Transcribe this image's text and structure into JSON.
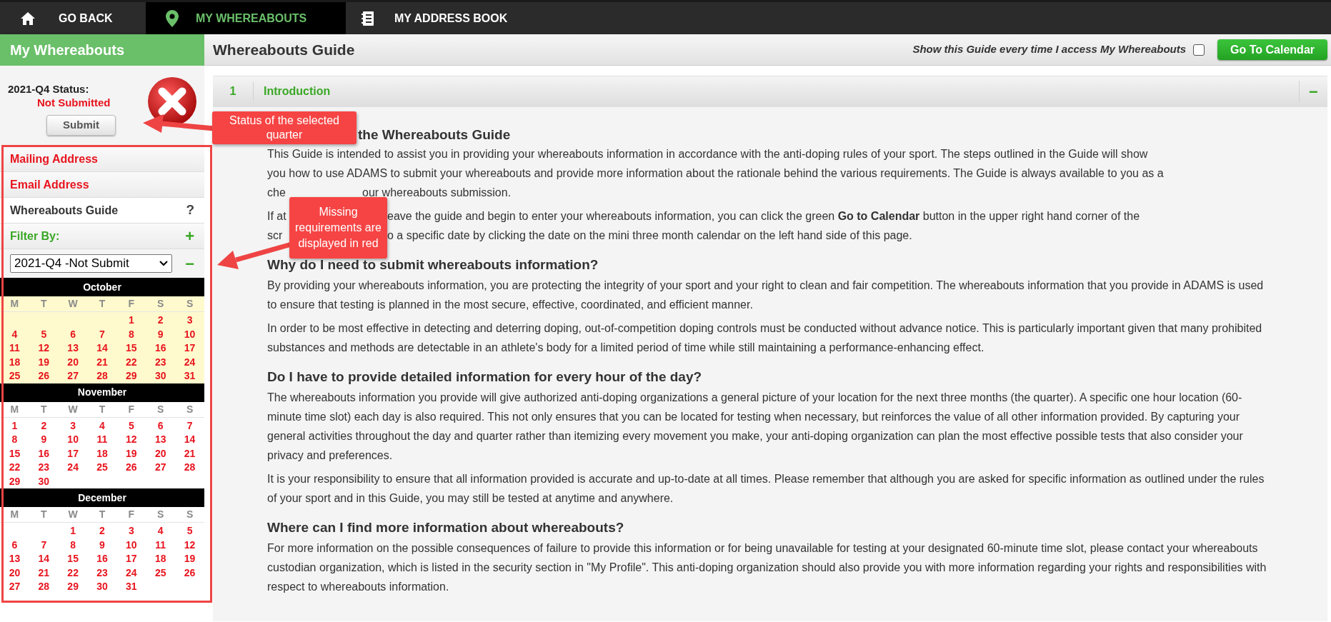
{
  "nav": [
    {
      "label": "GO BACK",
      "selected": false
    },
    {
      "label": "MY WHEREABOUTS",
      "selected": true
    },
    {
      "label": "MY ADDRESS BOOK",
      "selected": false
    }
  ],
  "sidebar": {
    "title": "My Whereabouts",
    "status": {
      "label": "2021-Q4 Status:",
      "value": "Not Submitted",
      "submitted": false
    },
    "submit_button": "Submit",
    "links": [
      {
        "kind": "link",
        "label": "Mailing Address",
        "missing": true
      },
      {
        "kind": "link",
        "label": "Email Address",
        "missing": true
      },
      {
        "kind": "help",
        "label": "Whereabouts Guide",
        "missing": false,
        "symbol": "?"
      },
      {
        "kind": "filter",
        "label": "Filter By:",
        "missing": false,
        "symbol": "+"
      }
    ],
    "quarter_select": {
      "value": "2021-Q4 -Not Submit",
      "symbol": "−"
    },
    "calendar": [
      {
        "month": "October",
        "current_quarter_highlight": true,
        "missing": true,
        "weekdays": [
          "M",
          "T",
          "W",
          "T",
          "F",
          "S",
          "S"
        ],
        "weeks": [
          [
            "1",
            "2",
            "3"
          ],
          [
            "4",
            "5",
            "6",
            "7",
            "8",
            "9",
            "10"
          ],
          [
            "11",
            "12",
            "13",
            "14",
            "15",
            "16",
            "17"
          ],
          [
            "18",
            "19",
            "20",
            "21",
            "22",
            "23",
            "24"
          ],
          [
            "25",
            "26",
            "27",
            "28",
            "29",
            "30",
            "31"
          ]
        ]
      },
      {
        "month": "November",
        "current_quarter_highlight": false,
        "missing": true,
        "weekdays": [
          "M",
          "T",
          "W",
          "T",
          "F",
          "S",
          "S"
        ],
        "weeks": [
          [
            "1",
            "2",
            "3",
            "4",
            "5",
            "6",
            "7"
          ],
          [
            "8",
            "9",
            "10",
            "11",
            "12",
            "13",
            "14"
          ],
          [
            "15",
            "16",
            "17",
            "18",
            "19",
            "20",
            "21"
          ],
          [
            "22",
            "23",
            "24",
            "25",
            "26",
            "27",
            "28"
          ],
          [
            "29",
            "30"
          ]
        ]
      },
      {
        "month": "December",
        "current_quarter_highlight": false,
        "missing": true,
        "weekdays": [
          "M",
          "T",
          "W",
          "T",
          "F",
          "S",
          "S"
        ],
        "weeks": [
          [
            "1",
            "2",
            "3",
            "4",
            "5"
          ],
          [
            "6",
            "7",
            "8",
            "9",
            "10",
            "11",
            "12"
          ],
          [
            "13",
            "14",
            "15",
            "16",
            "17",
            "18",
            "19"
          ],
          [
            "20",
            "21",
            "22",
            "23",
            "24",
            "25",
            "26"
          ],
          [
            "27",
            "28",
            "29",
            "30",
            "31"
          ]
        ]
      }
    ]
  },
  "main": {
    "title": "Whereabouts Guide",
    "show_guide": {
      "label": "Show this Guide every time I access My Whereabouts",
      "checked": false
    },
    "go_button": "Go To Calendar",
    "section": {
      "number": "1",
      "title": "Introduction",
      "expanded": true,
      "collapse_symbol": "−",
      "intro": {
        "heading": "the Whereabouts Guide",
        "paragraphs": [
          [
            {
              "text": "This Guide is intended to assist you in providing your whereabouts information in accordance with the anti-doping rules of your sport. The steps outlined in the Guide will show"
            },
            {
              "text": "you how to use ADAMS to submit your whereabouts and provide more information about the rationale behind the various requirements. The Guide is always available to you as a"
            },
            {
              "before": "che",
              "after": "our whereabouts submission."
            }
          ],
          [
            {
              "before": "If at",
              "after": "eave the guide and begin to enter your whereabouts information, you can click the green **Go to Calendar** button in the upper right hand corner of the"
            },
            {
              "before": "scr",
              "after": "o a specific date by clicking the date on the mini three month calendar on the left hand side of this page."
            }
          ]
        ]
      },
      "blocks": [
        {
          "heading": "Why do I need to submit whereabouts information?",
          "paragraphs": [
            "By providing your whereabouts information, you are protecting the integrity of your sport and your right to clean and fair competition. The whereabouts information that you provide in ADAMS is used to ensure that testing is planned in the most secure, effective, coordinated, and efficient manner.",
            "In order to be most effective in detecting and deterring doping, out-of-competition doping controls must be conducted without advance notice. This is particularly important given that many prohibited substances and methods are detectable in an athlete's body for a limited period of time while still maintaining a performance-enhancing effect."
          ]
        },
        {
          "heading": "Do I have to provide detailed information for every hour of the day?",
          "paragraphs": [
            "The whereabouts information you provide will give authorized anti-doping organizations a general picture of your location for the next three months (the quarter). A specific one hour location (60-minute time slot) each day is also required. This not only ensures that you can be located for testing when necessary, but reinforces the value of all other information provided. By capturing your general activities throughout the day and quarter rather than itemizing every movement you make, your anti-doping organization can plan the most effective possible tests that also consider your privacy and preferences.",
            "It is your responsibility to ensure that all information provided is accurate and up-to-date at all times. Please remember that although you are asked for specific information as outlined under the rules of your sport and in this Guide, you may still be tested at anytime and anywhere."
          ]
        },
        {
          "heading": "Where can I find more information about whereabouts?",
          "paragraphs": [
            "For more information on the possible consequences of failure to provide this information or for being unavailable for testing at your designated 60-minute time slot, please contact your whereabouts custodian organization, which is listed in the security section in \"My Profile\". This anti-doping organization should also provide you with more information regarding your rights and responsibilities with respect to whereabouts information."
          ]
        }
      ]
    }
  },
  "callouts": [
    {
      "text": "Status of the selected quarter"
    },
    {
      "text": "Missing requirements are displayed in red"
    }
  ]
}
